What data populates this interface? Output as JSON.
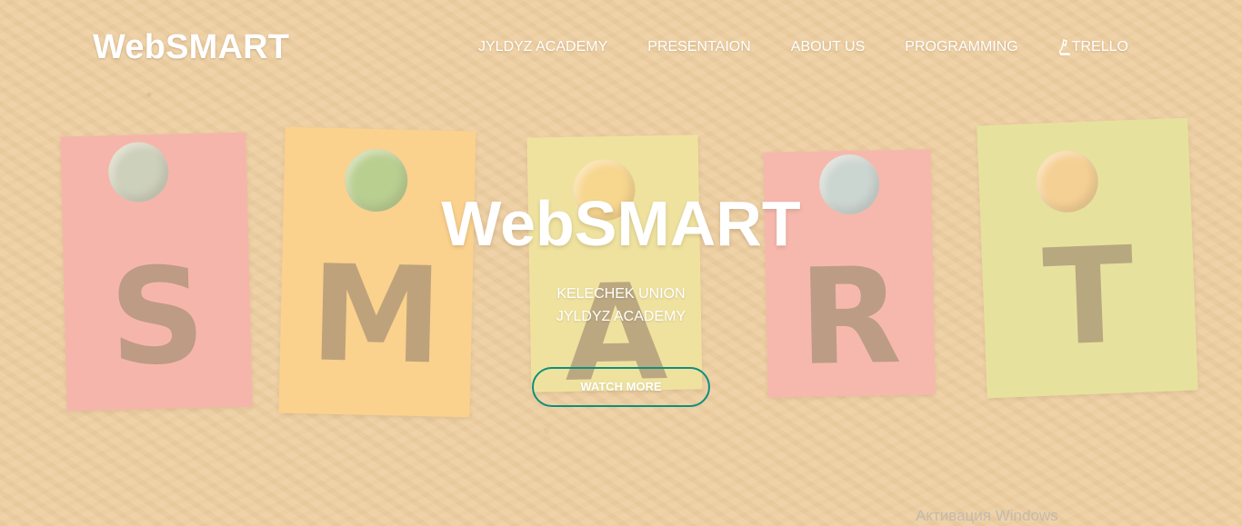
{
  "header": {
    "brand": "WebSMART",
    "nav": [
      {
        "label": "JYLDYZ ACADEMY"
      },
      {
        "label": "PRESENTAION"
      },
      {
        "label": "ABOUT US"
      },
      {
        "label": "PROGRAMMING"
      },
      {
        "label": "TRELLO",
        "icon": "microscope-icon"
      }
    ]
  },
  "background": {
    "letters": [
      "S",
      "M",
      "A",
      "R",
      "T"
    ],
    "colors": {
      "cork": "#e8c99a",
      "pink_note": "#f3a0a0",
      "orange_note": "#f8c775",
      "yellow_note": "#e9e08f",
      "lime_note": "#dddf8d",
      "button_border": "#0e8f7a"
    }
  },
  "hero": {
    "title": "WebSMART",
    "subtitle_line_1": "KELECHEK UNION",
    "subtitle_line_2": "JYLDYZ ACADEMY",
    "button_label": "WATCH MORE"
  },
  "watermark": {
    "text": "Активация Windows"
  }
}
